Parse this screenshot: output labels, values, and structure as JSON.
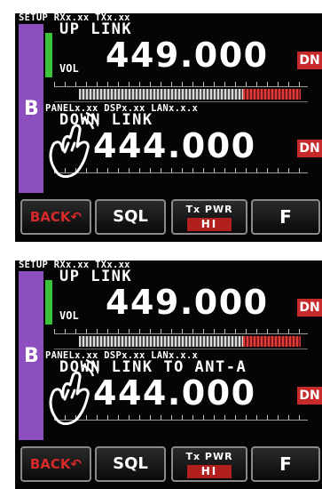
{
  "panels": [
    {
      "status_top": "SETUP RXx.xx TXx.xx",
      "status_mid": "PANELx.xx DSPx.xx LANx.x.x",
      "band": "B",
      "upper_label": "UP LINK",
      "upper_freq": "449.000",
      "vol_label": "VOL",
      "lower_label": "DOWN LINK",
      "lower_freq": "444.000",
      "dn_upper": "DN",
      "dn_lower": "DN"
    },
    {
      "status_top": "SETUP RXx.xx TXx.xx",
      "status_mid": "PANELx.xx DSPx.xx LANx.x.x",
      "band": "B",
      "upper_label": "UP LINK",
      "upper_freq": "449.000",
      "vol_label": "VOL",
      "lower_label": "DOWN LINK TO ANT-A",
      "lower_freq": "444.000",
      "dn_upper": "DN",
      "dn_lower": "DN"
    }
  ],
  "softkeys": {
    "back": "BACK",
    "sql": "SQL",
    "txpwr_title": "Tx PWR",
    "txpwr_value": "HI",
    "f": "F"
  },
  "colors": {
    "band_strip": "#8e4fbe",
    "signal": "#3bc43b",
    "dn_badge": "#c62a2a",
    "back_text": "#d62a2a"
  },
  "icons": [
    "touch-hand-icon",
    "back-arrow-icon"
  ],
  "meter_red_fraction": 0.26
}
